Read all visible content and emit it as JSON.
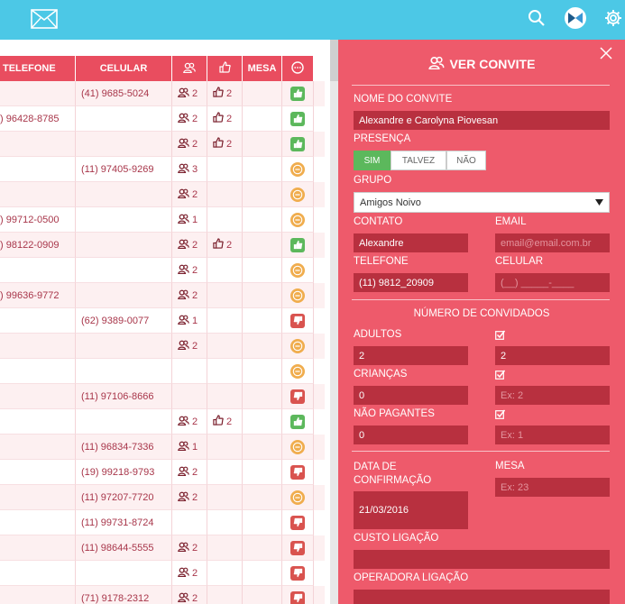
{
  "table": {
    "headers": {
      "telefone": "TELEFONE",
      "celular": "CELULAR",
      "mesa": "MESA"
    },
    "rows": [
      {
        "tel": "",
        "cel": "(41) 9685-5024",
        "ppl": "2",
        "likes": "2",
        "status": "ok"
      },
      {
        "tel": ") 96428-8785",
        "cel": "",
        "ppl": "2",
        "likes": "2",
        "status": "ok"
      },
      {
        "tel": "",
        "cel": "",
        "ppl": "2",
        "likes": "2",
        "status": "ok"
      },
      {
        "tel": "",
        "cel": "(11) 97405-9269",
        "ppl": "3",
        "likes": "",
        "status": "maybe"
      },
      {
        "tel": "",
        "cel": "",
        "ppl": "2",
        "likes": "",
        "status": "maybe"
      },
      {
        "tel": ") 99712-0500",
        "cel": "",
        "ppl": "1",
        "likes": "",
        "status": "maybe"
      },
      {
        "tel": ") 98122-0909",
        "cel": "",
        "ppl": "2",
        "likes": "2",
        "status": "ok"
      },
      {
        "tel": "",
        "cel": "",
        "ppl": "2",
        "likes": "",
        "status": "maybe"
      },
      {
        "tel": ") 99636-9772",
        "cel": "",
        "ppl": "2",
        "likes": "",
        "status": "maybe"
      },
      {
        "tel": "",
        "cel": "(62) 9389-0077",
        "ppl": "1",
        "likes": "",
        "status": "no"
      },
      {
        "tel": "",
        "cel": "",
        "ppl": "2",
        "likes": "",
        "status": "maybe"
      },
      {
        "tel": "",
        "cel": "",
        "ppl": "",
        "likes": "",
        "status": "maybe"
      },
      {
        "tel": "",
        "cel": "(11) 97106-8666",
        "ppl": "",
        "likes": "",
        "status": "no"
      },
      {
        "tel": "",
        "cel": "",
        "ppl": "2",
        "likes": "2",
        "status": "ok"
      },
      {
        "tel": "",
        "cel": "(11) 96834-7336",
        "ppl": "1",
        "likes": "",
        "status": "maybe"
      },
      {
        "tel": "",
        "cel": "(19) 99218-9793",
        "ppl": "2",
        "likes": "",
        "status": "no"
      },
      {
        "tel": "",
        "cel": "(11) 97207-7720",
        "ppl": "2",
        "likes": "",
        "status": "maybe"
      },
      {
        "tel": "",
        "cel": "(11) 99731-8724",
        "ppl": "",
        "likes": "",
        "status": "no"
      },
      {
        "tel": "",
        "cel": "(11) 98644-5555",
        "ppl": "2",
        "likes": "",
        "status": "no"
      },
      {
        "tel": "",
        "cel": "",
        "ppl": "2",
        "likes": "",
        "status": "no"
      },
      {
        "tel": "",
        "cel": "(71) 9178-2312",
        "ppl": "2",
        "likes": "",
        "status": "no"
      }
    ]
  },
  "panel": {
    "title": "VER CONVITE",
    "nome_label": "NOME DO CONVITE",
    "nome_value": "Alexandre e Carolyna Piovesan",
    "presenca_label": "PRESENÇA",
    "presenca_options": [
      "SIM",
      "TALVEZ",
      "NÃO"
    ],
    "presenca_selected": "SIM",
    "grupo_label": "GRUPO",
    "grupo_value": "Amigos Noivo",
    "contato_label": "CONTATO",
    "contato_value": "Alexandre",
    "email_label": "EMAIL",
    "email_placeholder": "email@email.com.br",
    "telefone_label": "TELEFONE",
    "telefone_value": "(11) 9812_20909",
    "celular_label": "CELULAR",
    "celular_placeholder": "(__) _____-____",
    "num_convidados_label": "NÚMERO DE CONVIDADOS",
    "adultos_label": "ADULTOS",
    "adultos_value": "2",
    "adultos_confirmed": "2",
    "criancas_label": "CRIANÇAS",
    "criancas_value": "0",
    "criancas_placeholder": "Ex: 2",
    "nao_pagantes_label": "NÃO PAGANTES",
    "nao_pagantes_value": "0",
    "nao_pagantes_placeholder": "Ex: 1",
    "data_label": "DATA DE CONFIRMAÇÃO",
    "data_value": "21/03/2016",
    "mesa_label": "MESA",
    "mesa_placeholder": "Ex: 23",
    "custo_label": "CUSTO LIGAÇÃO",
    "operadora_label": "OPERADORA LIGAÇÃO"
  },
  "colors": {
    "topbar": "#4cc8e6",
    "accent": "#e94d5f",
    "panel": "#ee5a6b",
    "field": "#b8303f",
    "ok": "#5cb85c",
    "maybe": "#f0ad4e",
    "no": "#d9534f"
  }
}
